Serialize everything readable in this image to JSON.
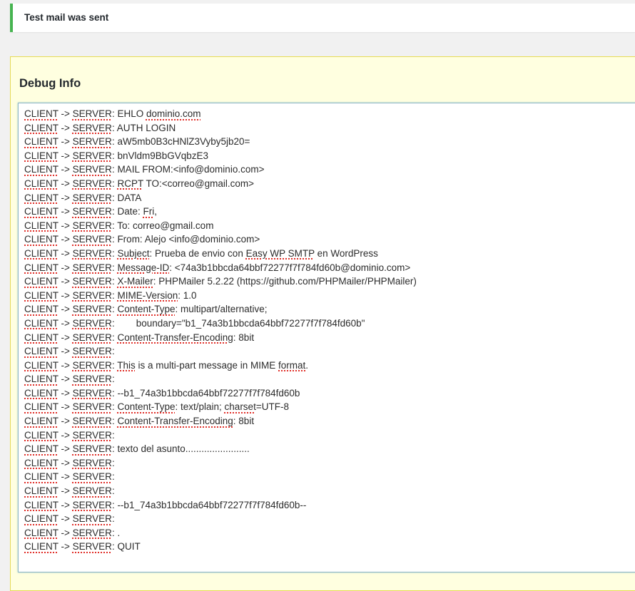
{
  "notice": {
    "text": "Test mail was sent",
    "accent_color": "#46b450"
  },
  "debug": {
    "title": "Debug Info",
    "box_background": "#ffffe0",
    "box_border": "#e6db55",
    "lines": [
      [
        {
          "t": "CLIENT",
          "s": 1
        },
        {
          "t": " -> ",
          "s": 0
        },
        {
          "t": "SERVER",
          "s": 1
        },
        {
          "t": ": EHLO ",
          "s": 0
        },
        {
          "t": "dominio.com",
          "s": 1
        }
      ],
      [
        {
          "t": "CLIENT",
          "s": 1
        },
        {
          "t": " -> ",
          "s": 0
        },
        {
          "t": "SERVER",
          "s": 1
        },
        {
          "t": ": AUTH LOGIN",
          "s": 0
        }
      ],
      [
        {
          "t": "CLIENT",
          "s": 1
        },
        {
          "t": " -> ",
          "s": 0
        },
        {
          "t": "SERVER",
          "s": 1
        },
        {
          "t": ": aW5mb0B3cHNlZ3Vyby5jb20=",
          "s": 0
        }
      ],
      [
        {
          "t": "CLIENT",
          "s": 1
        },
        {
          "t": " -> ",
          "s": 0
        },
        {
          "t": "SERVER",
          "s": 1
        },
        {
          "t": ": bnVldm9BbGVqbzE3",
          "s": 0
        }
      ],
      [
        {
          "t": "CLIENT",
          "s": 1
        },
        {
          "t": " -> ",
          "s": 0
        },
        {
          "t": "SERVER",
          "s": 1
        },
        {
          "t": ": MAIL FROM:<info@dominio.com>",
          "s": 0
        }
      ],
      [
        {
          "t": "CLIENT",
          "s": 1
        },
        {
          "t": " -> ",
          "s": 0
        },
        {
          "t": "SERVER",
          "s": 1
        },
        {
          "t": ": ",
          "s": 0
        },
        {
          "t": "RCPT",
          "s": 1
        },
        {
          "t": " TO:<correo@gmail.com>",
          "s": 0
        }
      ],
      [
        {
          "t": "CLIENT",
          "s": 1
        },
        {
          "t": " -> ",
          "s": 0
        },
        {
          "t": "SERVER",
          "s": 1
        },
        {
          "t": ": DATA",
          "s": 0
        }
      ],
      [
        {
          "t": "CLIENT",
          "s": 1
        },
        {
          "t": " -> ",
          "s": 0
        },
        {
          "t": "SERVER",
          "s": 1
        },
        {
          "t": ": Date: ",
          "s": 0
        },
        {
          "t": "Fri",
          "s": 1
        },
        {
          "t": ",",
          "s": 0
        }
      ],
      [
        {
          "t": "CLIENT",
          "s": 1
        },
        {
          "t": " -> ",
          "s": 0
        },
        {
          "t": "SERVER",
          "s": 1
        },
        {
          "t": ": To: correo@gmail.com",
          "s": 0
        }
      ],
      [
        {
          "t": "CLIENT",
          "s": 1
        },
        {
          "t": " -> ",
          "s": 0
        },
        {
          "t": "SERVER",
          "s": 1
        },
        {
          "t": ": From: Alejo <info@dominio.com>",
          "s": 0
        }
      ],
      [
        {
          "t": "CLIENT",
          "s": 1
        },
        {
          "t": " -> ",
          "s": 0
        },
        {
          "t": "SERVER",
          "s": 1
        },
        {
          "t": ": ",
          "s": 0
        },
        {
          "t": "Subject",
          "s": 1
        },
        {
          "t": ": Prueba de envio con ",
          "s": 0
        },
        {
          "t": "Easy WP SMTP",
          "s": 1
        },
        {
          "t": " en WordPress",
          "s": 0
        }
      ],
      [
        {
          "t": "CLIENT",
          "s": 1
        },
        {
          "t": " -> ",
          "s": 0
        },
        {
          "t": "SERVER",
          "s": 1
        },
        {
          "t": ": ",
          "s": 0
        },
        {
          "t": "Message-ID",
          "s": 1
        },
        {
          "t": ": <74a3b1bbcda64bbf72277f7f784fd60b@dominio.com>",
          "s": 0
        }
      ],
      [
        {
          "t": "CLIENT",
          "s": 1
        },
        {
          "t": " -> ",
          "s": 0
        },
        {
          "t": "SERVER",
          "s": 1
        },
        {
          "t": ": ",
          "s": 0
        },
        {
          "t": "X-Mailer",
          "s": 1
        },
        {
          "t": ": PHPMailer 5.2.22 (https://github.com/PHPMailer/PHPMailer)",
          "s": 0
        }
      ],
      [
        {
          "t": "CLIENT",
          "s": 1
        },
        {
          "t": " -> ",
          "s": 0
        },
        {
          "t": "SERVER",
          "s": 1
        },
        {
          "t": ": ",
          "s": 0
        },
        {
          "t": "MIME-Version",
          "s": 1
        },
        {
          "t": ": 1.0",
          "s": 0
        }
      ],
      [
        {
          "t": "CLIENT",
          "s": 1
        },
        {
          "t": " -> ",
          "s": 0
        },
        {
          "t": "SERVER",
          "s": 1
        },
        {
          "t": ": ",
          "s": 0
        },
        {
          "t": "Content-Type",
          "s": 1
        },
        {
          "t": ": multipart/alternative;",
          "s": 0
        }
      ],
      [
        {
          "t": "CLIENT",
          "s": 1
        },
        {
          "t": " -> ",
          "s": 0
        },
        {
          "t": "SERVER",
          "s": 1
        },
        {
          "t": ":        boundary=\"b1_74a3b1bbcda64bbf72277f7f784fd60b\"",
          "s": 0
        }
      ],
      [
        {
          "t": "CLIENT",
          "s": 1
        },
        {
          "t": " -> ",
          "s": 0
        },
        {
          "t": "SERVER",
          "s": 1
        },
        {
          "t": ": ",
          "s": 0
        },
        {
          "t": "Content-Transfer-Encoding",
          "s": 1
        },
        {
          "t": ": 8bit",
          "s": 0
        }
      ],
      [
        {
          "t": "CLIENT",
          "s": 1
        },
        {
          "t": " -> ",
          "s": 0
        },
        {
          "t": "SERVER",
          "s": 1
        },
        {
          "t": ":",
          "s": 0
        }
      ],
      [
        {
          "t": "CLIENT",
          "s": 1
        },
        {
          "t": " -> ",
          "s": 0
        },
        {
          "t": "SERVER",
          "s": 1
        },
        {
          "t": ": ",
          "s": 0
        },
        {
          "t": "This",
          "s": 1
        },
        {
          "t": " is a multi-part message in MIME ",
          "s": 0
        },
        {
          "t": "format",
          "s": 1
        },
        {
          "t": ".",
          "s": 0
        }
      ],
      [
        {
          "t": "CLIENT",
          "s": 1
        },
        {
          "t": " -> ",
          "s": 0
        },
        {
          "t": "SERVER",
          "s": 1
        },
        {
          "t": ":",
          "s": 0
        }
      ],
      [
        {
          "t": "CLIENT",
          "s": 1
        },
        {
          "t": " -> ",
          "s": 0
        },
        {
          "t": "SERVER",
          "s": 1
        },
        {
          "t": ": --b1_74a3b1bbcda64bbf72277f7f784fd60b",
          "s": 0
        }
      ],
      [
        {
          "t": "CLIENT",
          "s": 1
        },
        {
          "t": " -> ",
          "s": 0
        },
        {
          "t": "SERVER",
          "s": 1
        },
        {
          "t": ": ",
          "s": 0
        },
        {
          "t": "Content-Type",
          "s": 1
        },
        {
          "t": ": text/plain; ",
          "s": 0
        },
        {
          "t": "charset",
          "s": 1
        },
        {
          "t": "=UTF-8",
          "s": 0
        }
      ],
      [
        {
          "t": "CLIENT",
          "s": 1
        },
        {
          "t": " -> ",
          "s": 0
        },
        {
          "t": "SERVER",
          "s": 1
        },
        {
          "t": ": ",
          "s": 0
        },
        {
          "t": "Content-Transfer-Encoding",
          "s": 1
        },
        {
          "t": ": 8bit",
          "s": 0
        }
      ],
      [
        {
          "t": "CLIENT",
          "s": 1
        },
        {
          "t": " -> ",
          "s": 0
        },
        {
          "t": "SERVER",
          "s": 1
        },
        {
          "t": ":",
          "s": 0
        }
      ],
      [
        {
          "t": "CLIENT",
          "s": 1
        },
        {
          "t": " -> ",
          "s": 0
        },
        {
          "t": "SERVER",
          "s": 1
        },
        {
          "t": ": texto del asunto........................",
          "s": 0
        }
      ],
      [
        {
          "t": "CLIENT",
          "s": 1
        },
        {
          "t": " -> ",
          "s": 0
        },
        {
          "t": "SERVER",
          "s": 1
        },
        {
          "t": ":",
          "s": 0
        }
      ],
      [
        {
          "t": "CLIENT",
          "s": 1
        },
        {
          "t": " -> ",
          "s": 0
        },
        {
          "t": "SERVER",
          "s": 1
        },
        {
          "t": ":",
          "s": 0
        }
      ],
      [
        {
          "t": "CLIENT",
          "s": 1
        },
        {
          "t": " -> ",
          "s": 0
        },
        {
          "t": "SERVER",
          "s": 1
        },
        {
          "t": ":",
          "s": 0
        }
      ],
      [
        {
          "t": "CLIENT",
          "s": 1
        },
        {
          "t": " -> ",
          "s": 0
        },
        {
          "t": "SERVER",
          "s": 1
        },
        {
          "t": ": --b1_74a3b1bbcda64bbf72277f7f784fd60b--",
          "s": 0
        }
      ],
      [
        {
          "t": "CLIENT",
          "s": 1
        },
        {
          "t": " -> ",
          "s": 0
        },
        {
          "t": "SERVER",
          "s": 1
        },
        {
          "t": ":",
          "s": 0
        }
      ],
      [
        {
          "t": "CLIENT",
          "s": 1
        },
        {
          "t": " -> ",
          "s": 0
        },
        {
          "t": "SERVER",
          "s": 1
        },
        {
          "t": ": .",
          "s": 0
        }
      ],
      [
        {
          "t": "CLIENT",
          "s": 1
        },
        {
          "t": " -> ",
          "s": 0
        },
        {
          "t": "SERVER",
          "s": 1
        },
        {
          "t": ": QUIT",
          "s": 0
        }
      ]
    ]
  }
}
